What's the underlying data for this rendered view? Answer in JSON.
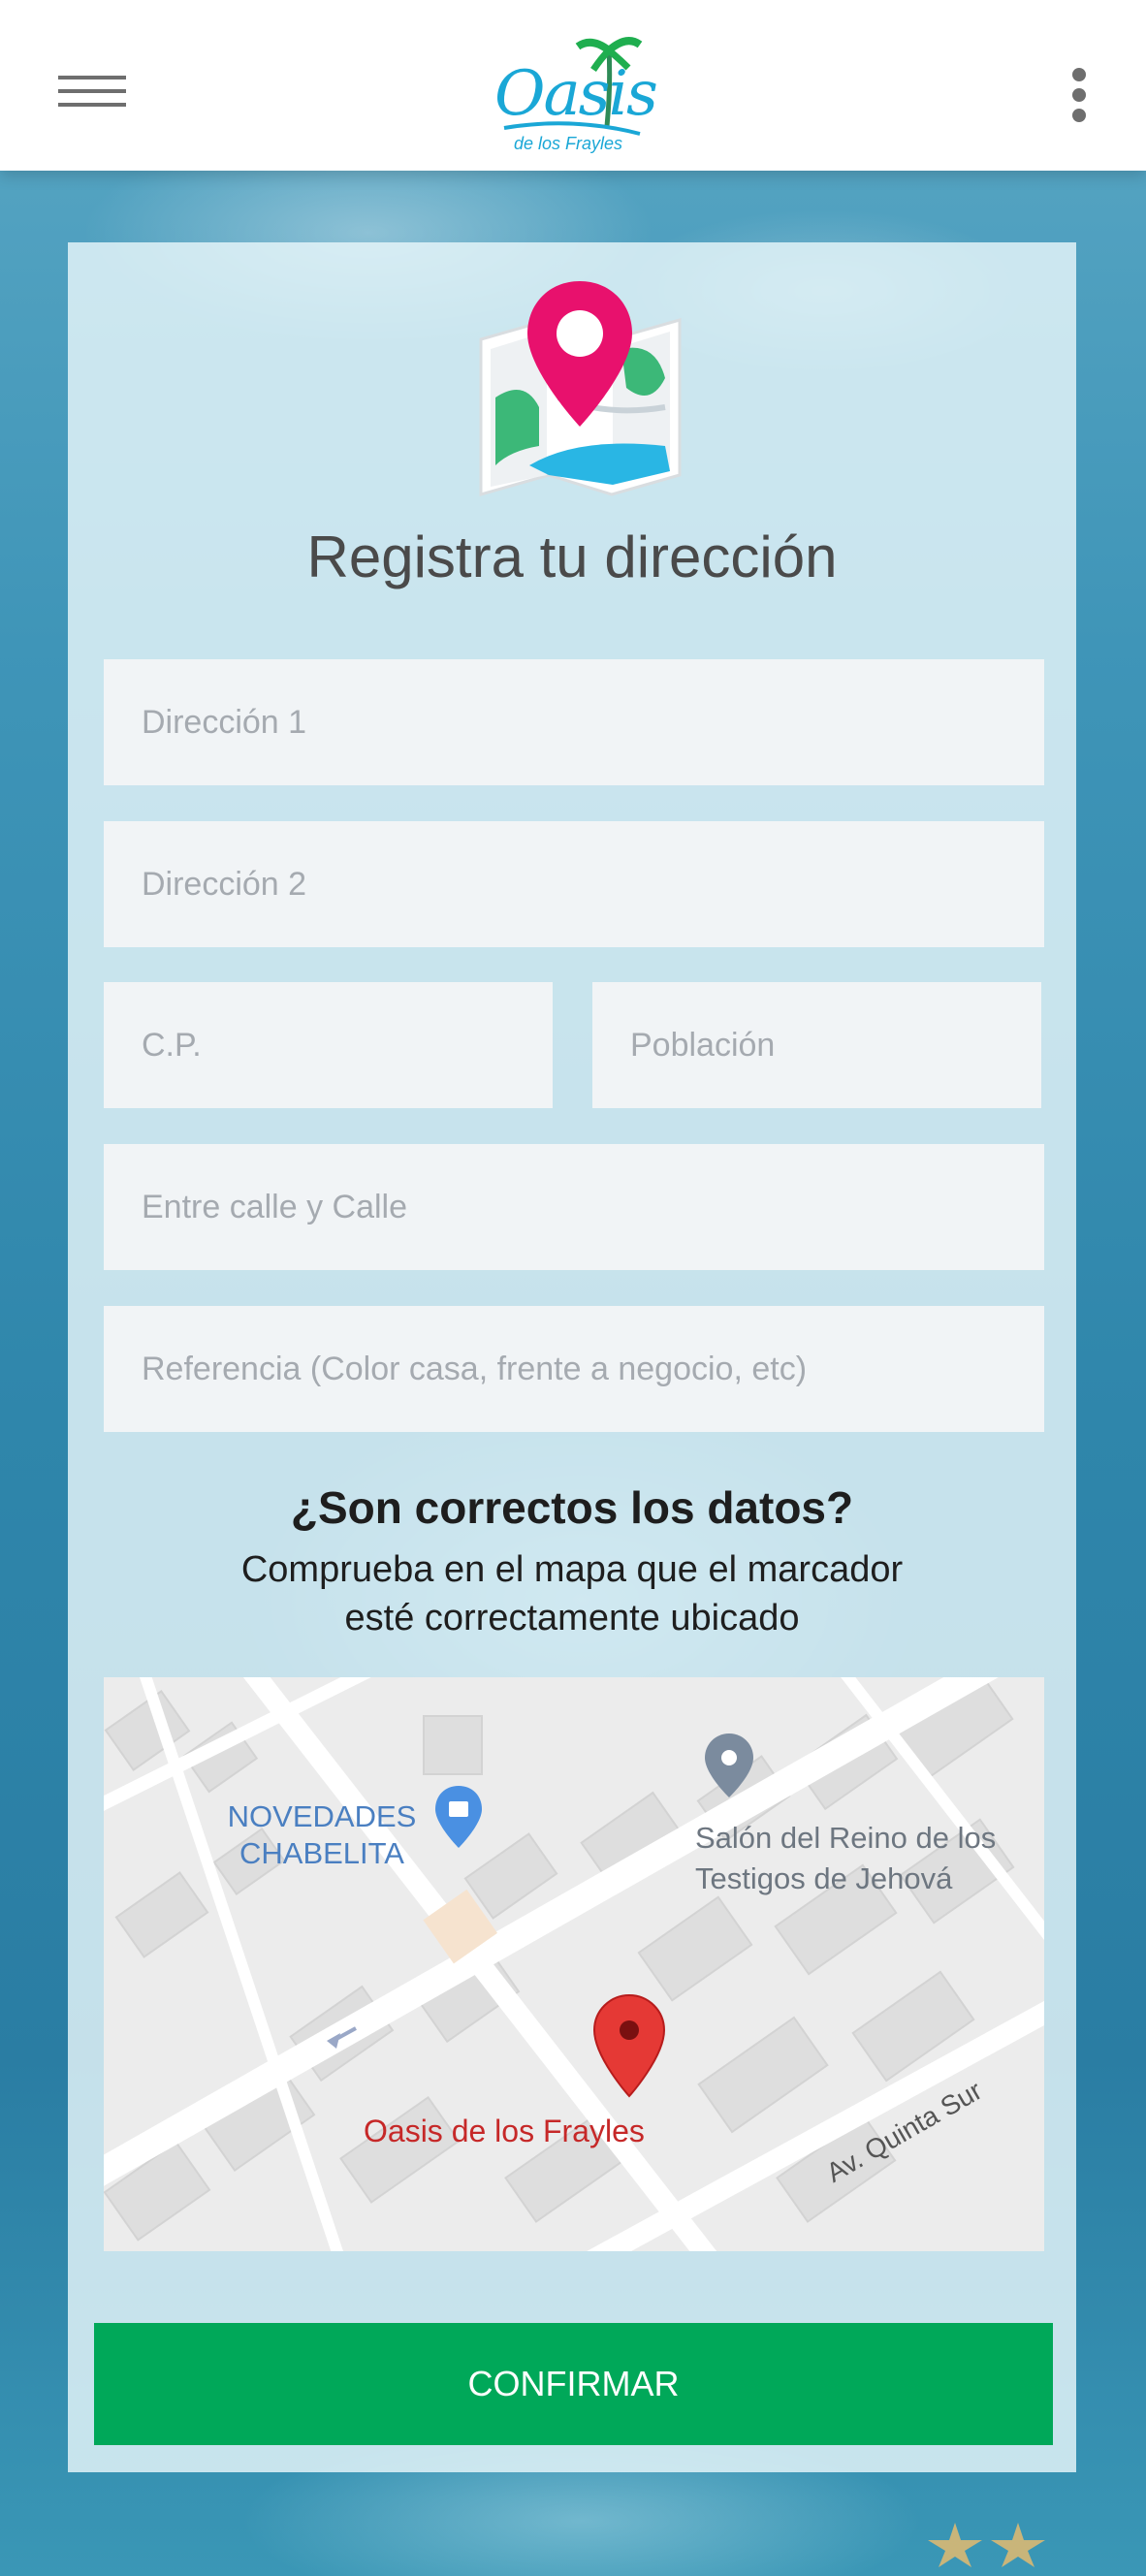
{
  "header": {
    "logo_text": "Oasis",
    "logo_subtext": "de los Frayles",
    "menu_icon": "hamburger-menu-icon",
    "overflow_icon": "more-vertical-icon"
  },
  "form": {
    "icon": "map-pin-icon",
    "title": "Registra tu dirección",
    "fields": {
      "address1": {
        "placeholder": "Dirección 1",
        "value": ""
      },
      "address2": {
        "placeholder": "Dirección 2",
        "value": ""
      },
      "postal_code": {
        "placeholder": "C.P.",
        "value": ""
      },
      "town": {
        "placeholder": "Población",
        "value": ""
      },
      "between_streets": {
        "placeholder": "Entre calle y Calle",
        "value": ""
      },
      "reference": {
        "placeholder": "Referencia (Color casa, frente a negocio, etc)",
        "value": ""
      }
    }
  },
  "verify": {
    "title": "¿Son correctos los datos?",
    "subtitle_line1": "Comprueba en el mapa que el marcador",
    "subtitle_line2": "esté correctamente ubicado"
  },
  "map": {
    "labels": {
      "shop_line1": "NOVEDADES",
      "shop_line2": "CHABELITA",
      "hall_line1": "Salón del Reino de los",
      "hall_line2": "Testigos de Jehová",
      "marker_label": "Oasis de los Frayles",
      "street": "Av. Quinta Sur"
    },
    "colors": {
      "marker": "#e53935",
      "poi_blue": "#4a90e2",
      "poi_gray": "#7b8b9e",
      "label_red": "#c62828"
    }
  },
  "actions": {
    "confirm_label": "CONFIRMAR"
  },
  "colors": {
    "accent_green": "#00a859",
    "logo_blue": "#1aa7d6",
    "pin_pink": "#e8116d"
  }
}
